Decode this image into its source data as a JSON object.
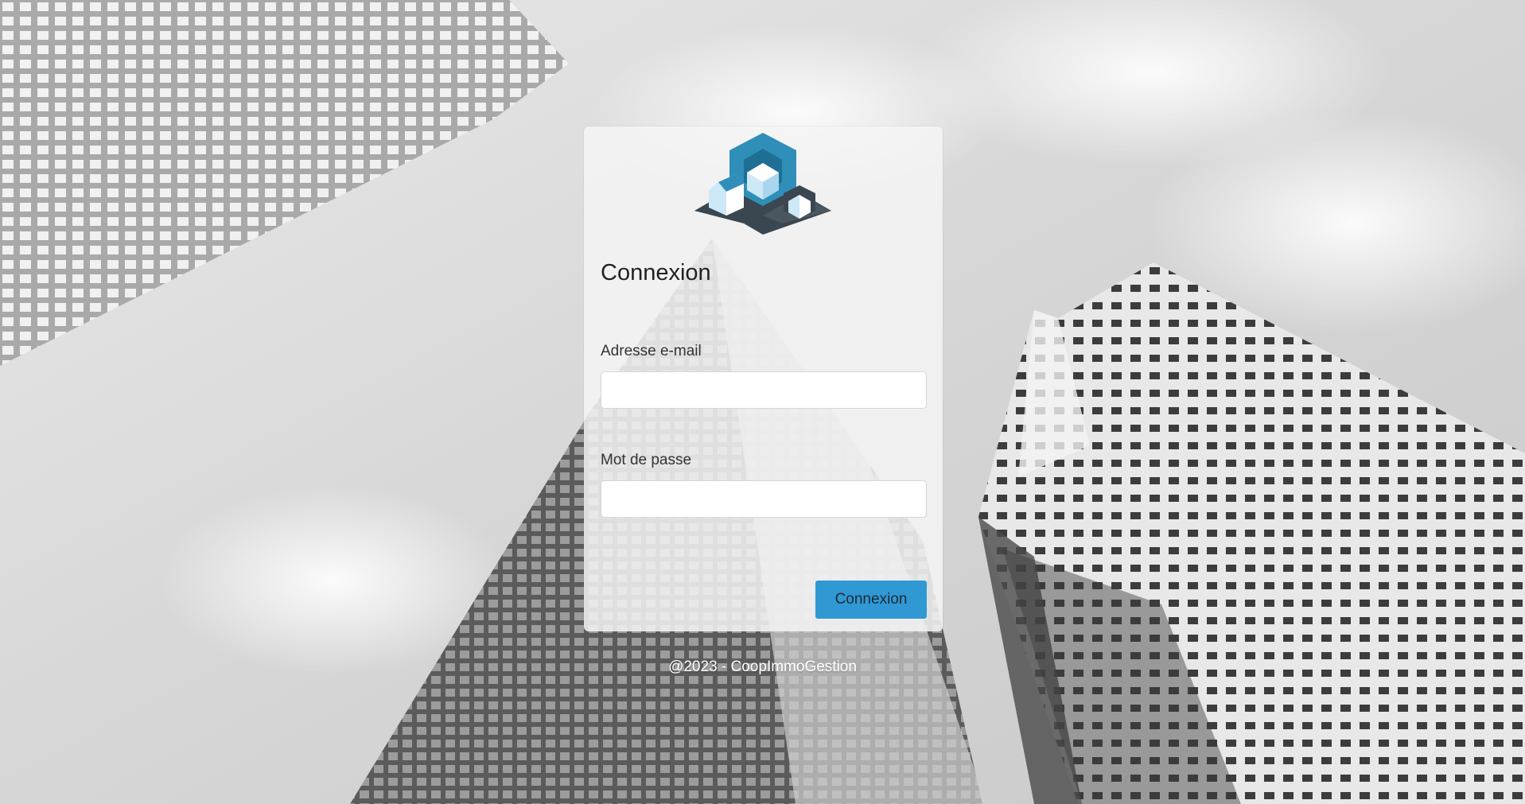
{
  "login": {
    "title": "Connexion",
    "email_label": "Adresse e-mail",
    "email_value": "",
    "password_label": "Mot de passe",
    "password_value": "",
    "submit_label": "Connexion"
  },
  "footer": {
    "text": "@2023 - CoopImmoGestion"
  },
  "colors": {
    "accent": "#3099d4",
    "logo_blue": "#2f8fb8",
    "logo_light": "#cde9f7",
    "logo_dark": "#3a4650"
  },
  "icons": {
    "logo": "coopimmogestion-logo"
  }
}
